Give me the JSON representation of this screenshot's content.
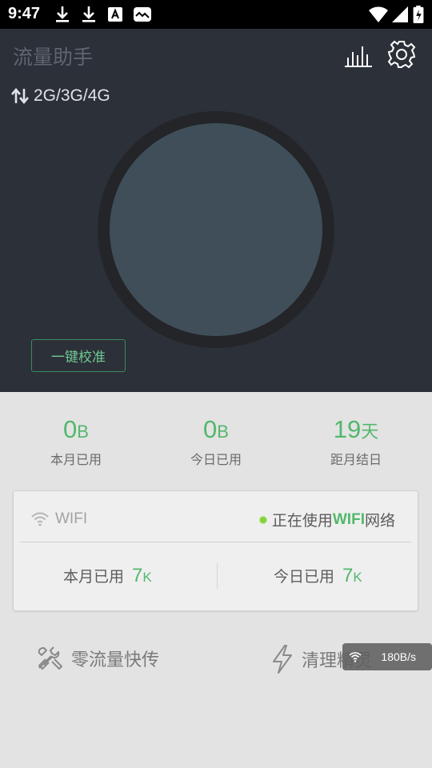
{
  "status_bar": {
    "time": "9:47",
    "icons": [
      "download-icon",
      "download-icon",
      "a-box-icon",
      "photo-icon",
      "wifi-icon",
      "signal-icon",
      "battery-charging-icon"
    ]
  },
  "header": {
    "title": "流量助手",
    "icons": [
      "bar-chart-icon",
      "gear-icon"
    ]
  },
  "network": {
    "icon": "up-down-arrows-icon",
    "label": "2G/3G/4G"
  },
  "calibrate_button": "一键校准",
  "summary": [
    {
      "value": "0",
      "unit": "B",
      "label": "本月已用"
    },
    {
      "value": "0",
      "unit": "B",
      "label": "今日已用"
    },
    {
      "value": "19",
      "unit": "天",
      "label": "距月结日"
    }
  ],
  "wifi_card": {
    "label": "WIFI",
    "status_prefix": "正在使用",
    "status_strong": "WIFI",
    "status_suffix": "网络",
    "month": {
      "label": "本月已用",
      "value": "7",
      "unit": "K"
    },
    "today": {
      "label": "今日已用",
      "value": "7",
      "unit": "K"
    }
  },
  "tools": {
    "zero_transfer": "零流量快传",
    "cleaner": "清理精灵"
  },
  "speed_badge": "180B/s",
  "colors": {
    "accent": "#52b86c",
    "dark_panel": "#2c3038",
    "gauge": "#3f4e59"
  }
}
